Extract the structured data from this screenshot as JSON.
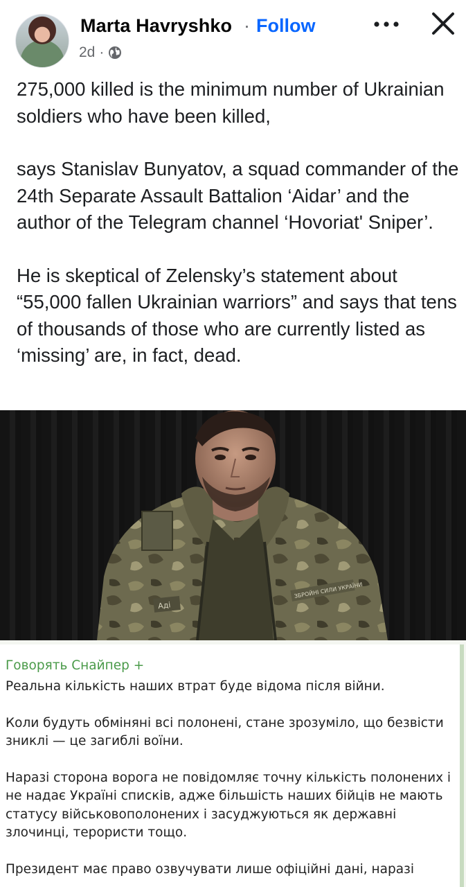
{
  "post": {
    "author": "Marta Havryshko",
    "separator": "·",
    "follow_label": "Follow",
    "time": "2d",
    "time_separator": "·",
    "paragraphs": [
      "275,000 killed is the minimum number of Ukrainian soldiers who have been killed,",
      "says Stanislav Bunyatov, a squad commander of the 24th Separate Assault Battalion ‘Aidar’ and the author of the Telegram channel ‘Hovoriat' Sniper’.",
      "He is skeptical of Zelensky’s statement about “55,000 fallen Ukrainian warriors” and says that tens of thousands of those who are currently listed as ‘missing’ are, in fact, dead."
    ]
  },
  "telegram": {
    "channel": "Говорять Снайпер +",
    "paragraphs": [
      "Реальна кількість наших втрат буде відома після війни.",
      "Коли будуть обміняні всі полонені, стане зрозуміло, що безвісти зниклі — це загиблі воїни.",
      "Наразі сторона ворога не повідомляє точну кількість полонених і не надає Україні списків, адже більшість наших бійців не мають статусу військовополонених і засуджуються як державні злочинці, терористи тощо.",
      "Президент має право озвучувати лише офіційні дані, наразі"
    ]
  },
  "photo": {
    "patch_text": "Аді",
    "tape_text": "ЗБРОЙНІ СИЛИ УКРАЇНИ"
  },
  "icons": {
    "globe": "globe-icon",
    "more": "more-options-icon",
    "close": "close-icon"
  },
  "colors": {
    "follow": "#0866ff",
    "meta": "#65676b",
    "telegram_author": "#4a9a49"
  }
}
